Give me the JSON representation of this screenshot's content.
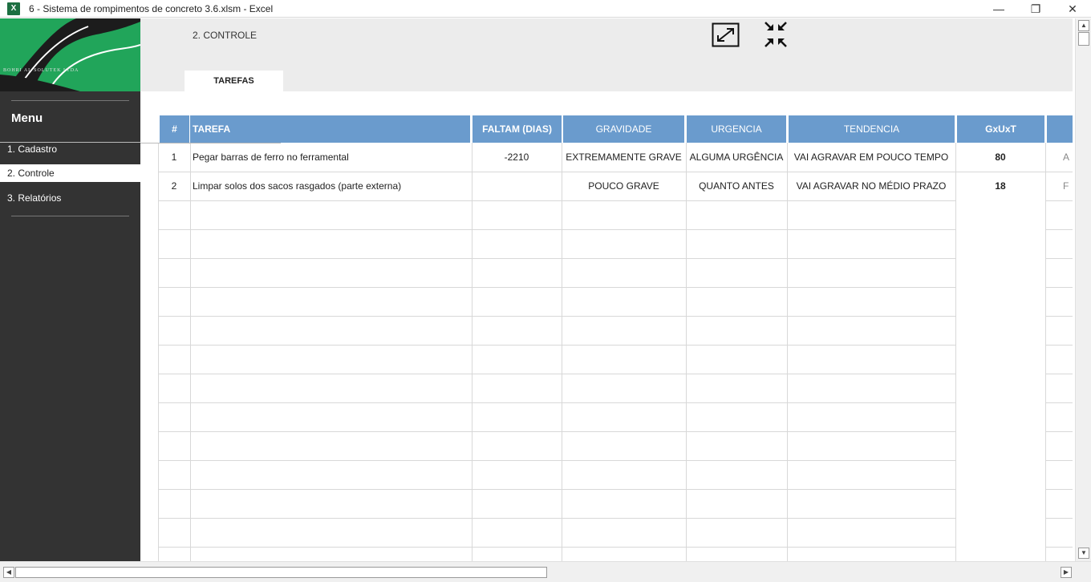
{
  "window": {
    "title": "6 - Sistema de rompimentos de concreto 3.6.xlsm - Excel",
    "app_icon_letter": "X",
    "minimize_glyph": "—",
    "maximize_glyph": "❐",
    "close_glyph": "✕"
  },
  "sidebar": {
    "logo_text": "BOHRI AL SOLUTEK LTDA",
    "menu_title": "Menu",
    "items": [
      {
        "label": "1. Cadastro",
        "active": false
      },
      {
        "label": "2. Controle",
        "active": true
      },
      {
        "label": "3. Relatórios",
        "active": false
      }
    ]
  },
  "header": {
    "page_title": "2. CONTROLE",
    "tab_label": "TAREFAS",
    "expand_icon": "expand-icon",
    "compress_icon": "compress-icon"
  },
  "table": {
    "columns": [
      "#",
      "TAREFA",
      "FALTAM (DIAS)",
      "GRAVIDADE",
      "URGENCIA",
      "TENDENCIA",
      "GxUxT"
    ],
    "rows": [
      {
        "num": "1",
        "tarefa": "Pegar barras de ferro no ferramental",
        "faltam": "-2210",
        "gravidade": "EXTREMAMENTE GRAVE",
        "urgencia": "ALGUMA URGÊNCIA",
        "tendencia": "VAI AGRAVAR EM POUCO TEMPO",
        "gxuxt": "80",
        "extra": "A"
      },
      {
        "num": "2",
        "tarefa": "Limpar solos dos sacos rasgados (parte externa)",
        "faltam": "",
        "gravidade": "POUCO GRAVE",
        "urgencia": "QUANTO ANTES",
        "tendencia": "VAI AGRAVAR NO MÉDIO PRAZO",
        "gxuxt": "18",
        "extra": "F"
      }
    ]
  },
  "colors": {
    "header_blue": "#6a9bcd",
    "sidebar_dark": "#333333",
    "logo_green": "#21a55a"
  }
}
